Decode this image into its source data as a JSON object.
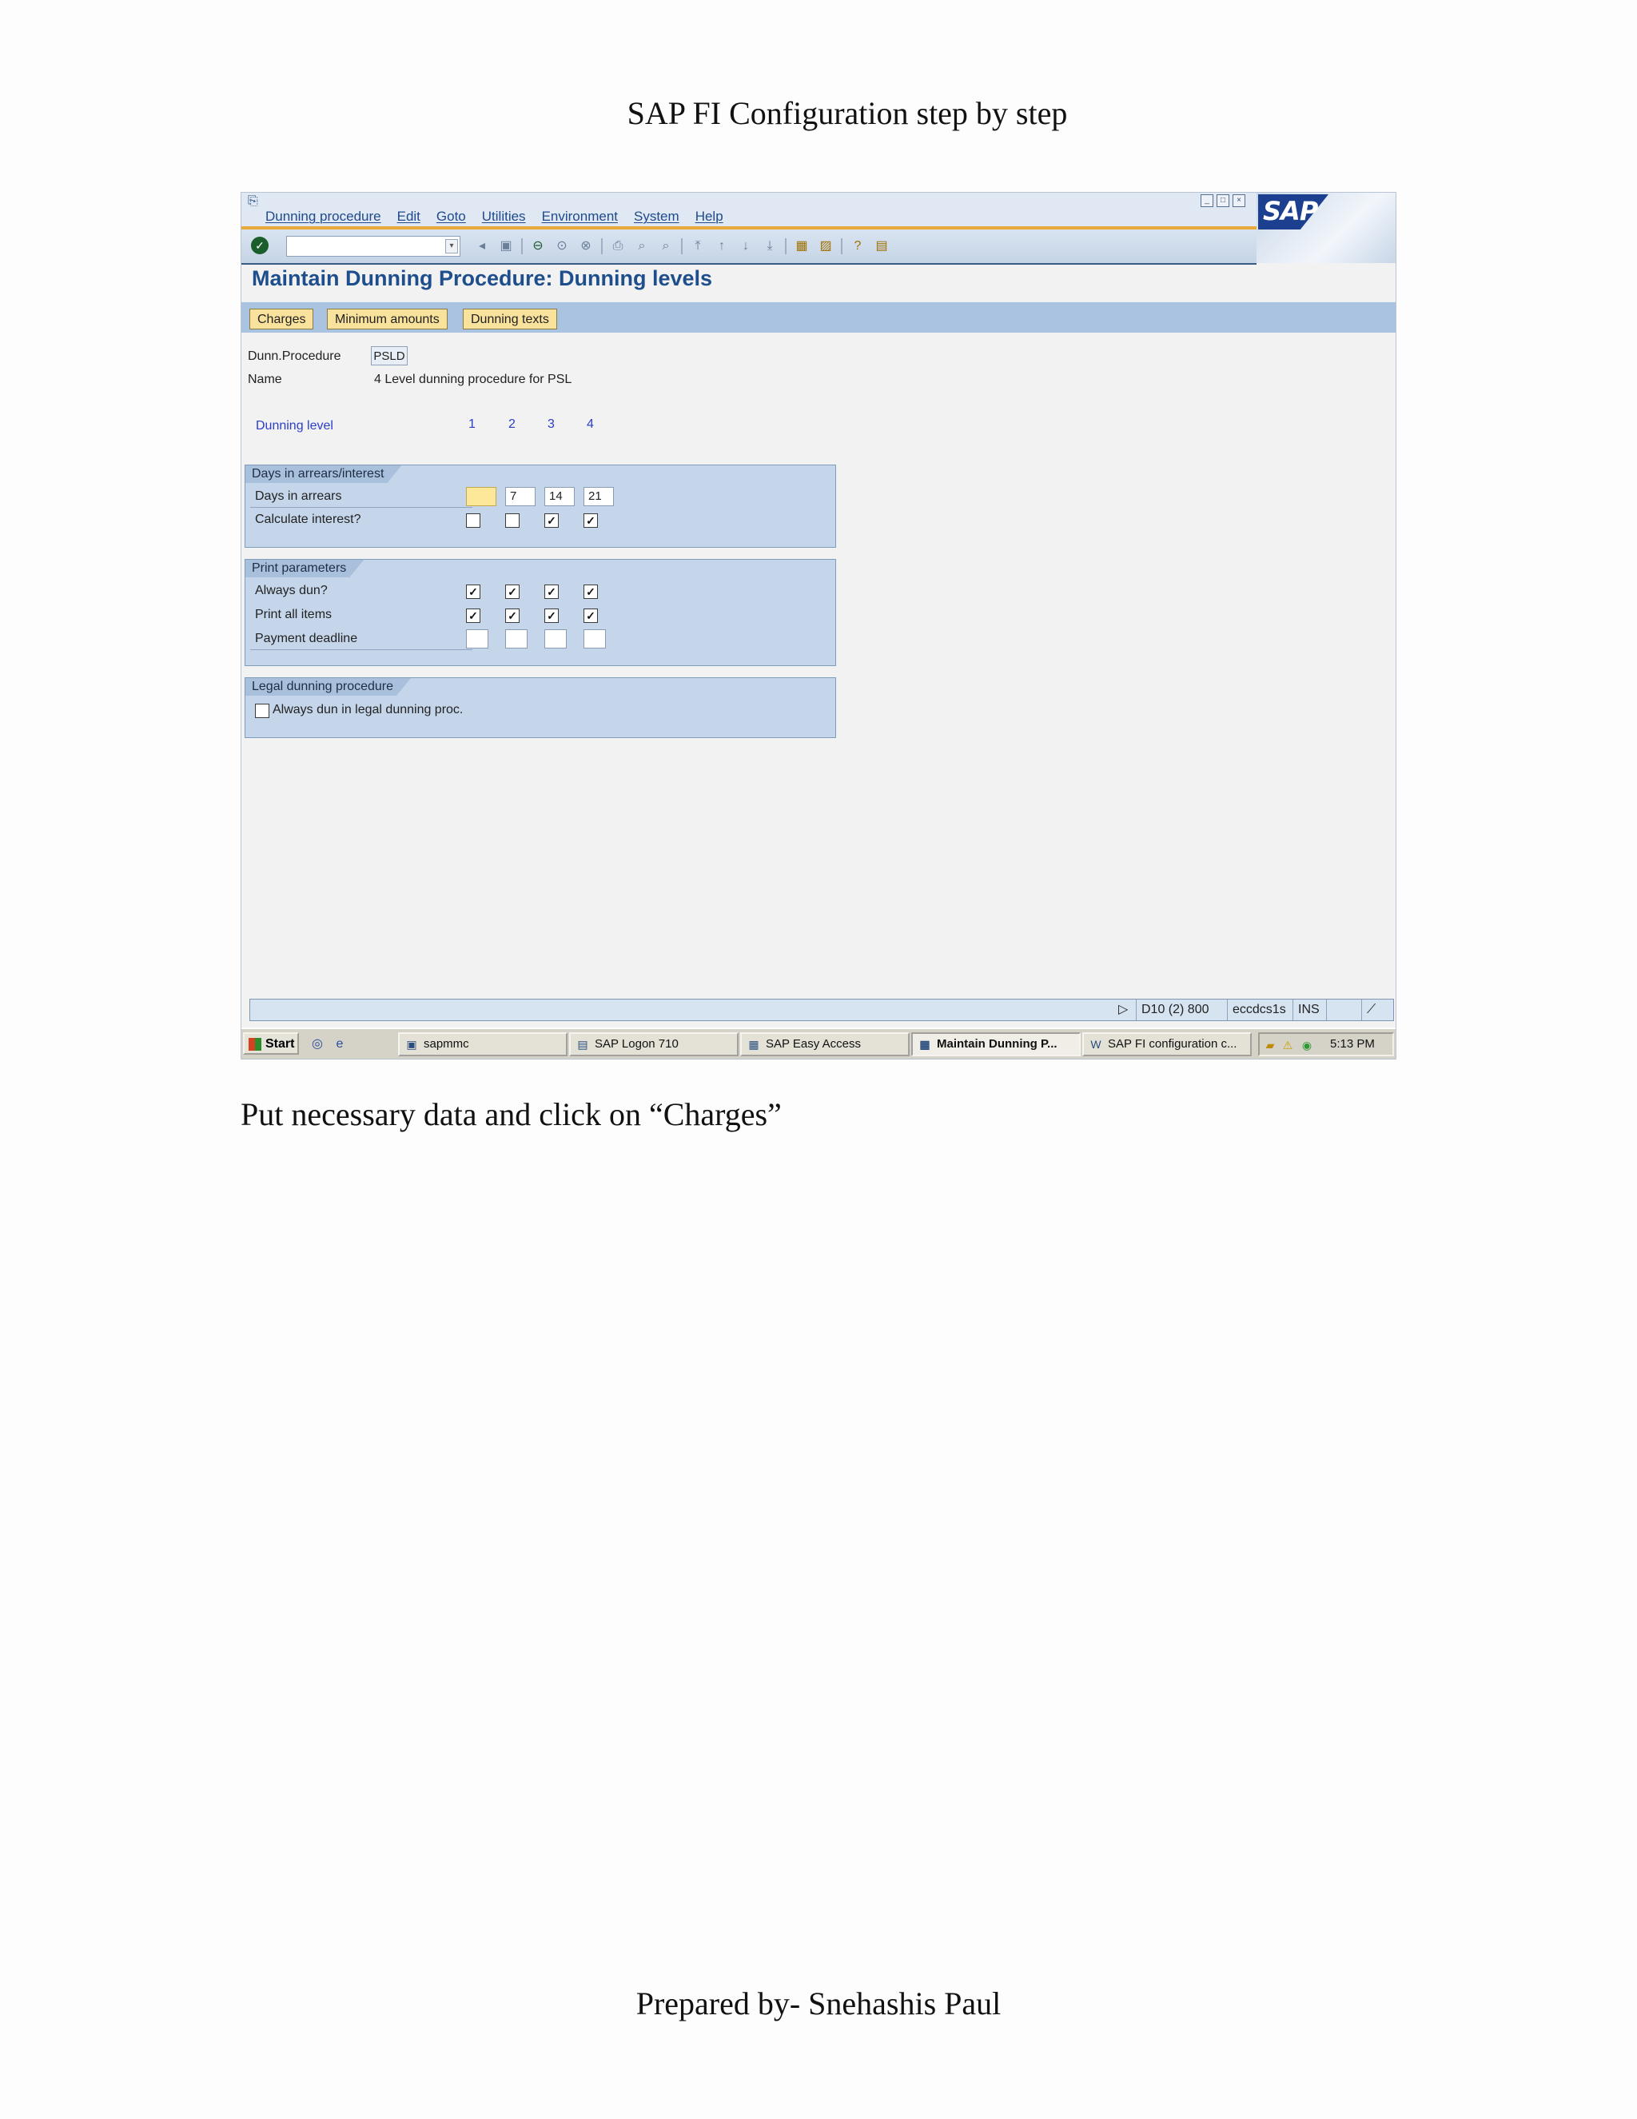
{
  "document": {
    "header": "SAP FI Configuration step by step",
    "caption": "Put necessary data and click on “Charges”",
    "footer": "Prepared by- Snehashis Paul"
  },
  "sap": {
    "menu": [
      "Dunning procedure",
      "Edit",
      "Goto",
      "Utilities",
      "Environment",
      "System",
      "Help"
    ],
    "logo_text": "SAP",
    "screen_title": "Maintain Dunning Procedure: Dunning levels",
    "app_buttons": [
      "Charges",
      "Minimum amounts",
      "Dunning texts"
    ],
    "fields": {
      "procedure_label": "Dunn.Procedure",
      "procedure_value": "PSLD",
      "name_label": "Name",
      "name_value": "4 Level dunning procedure for PSL",
      "level_label": "Dunning level",
      "levels": [
        "1",
        "2",
        "3",
        "4"
      ]
    },
    "groups": {
      "arrears": {
        "title": "Days in arrears/interest",
        "days_label": "Days in arrears",
        "days_values": [
          "",
          "7",
          "14",
          "21"
        ],
        "interest_label": "Calculate interest?",
        "interest_checked": [
          false,
          false,
          true,
          true
        ]
      },
      "print": {
        "title": "Print parameters",
        "always_dun_label": "Always dun?",
        "always_dun_checked": [
          true,
          true,
          true,
          true
        ],
        "print_all_label": "Print all items",
        "print_all_checked": [
          true,
          true,
          true,
          true
        ],
        "deadline_label": "Payment deadline",
        "deadline_values": [
          "",
          "",
          "",
          ""
        ]
      },
      "legal": {
        "title": "Legal dunning procedure",
        "always_legal_label": "Always dun in legal dunning proc.",
        "always_legal_checked": false
      }
    },
    "status": {
      "system": "D10 (2) 800",
      "server": "eccdcs1s",
      "mode": "INS"
    },
    "taskbar": {
      "start": "Start",
      "tasks": [
        "sapmmc",
        "SAP Logon 710",
        "SAP Easy Access",
        "Maintain Dunning P...",
        "SAP FI configuration c..."
      ],
      "clock": "5:13 PM"
    }
  }
}
